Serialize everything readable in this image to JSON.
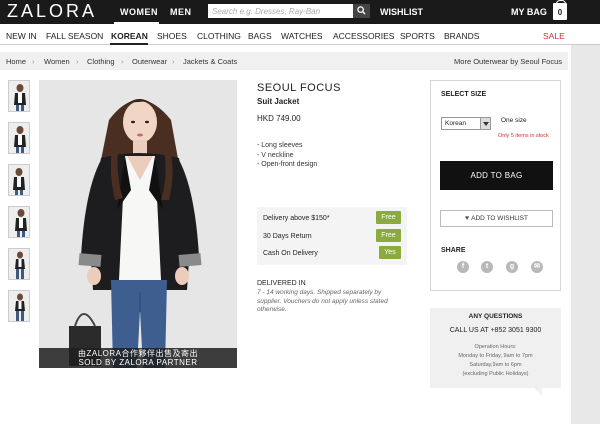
{
  "header": {
    "logo": "ZALORA",
    "nav": {
      "women": "WOMEN",
      "men": "MEN"
    },
    "search_placeholder": "Search e.g. Dresses, Ray-Ban",
    "wishlist": "WISHLIST",
    "mybag": "MY BAG",
    "bag_count": "0"
  },
  "categories": [
    "NEW IN",
    "FALL SEASON",
    "KOREAN",
    "SHOES",
    "CLOTHING",
    "BAGS",
    "WATCHES",
    "ACCESSORIES",
    "SPORTS",
    "BRANDS",
    "SALE"
  ],
  "breadcrumb": {
    "items": [
      "Home",
      "Women",
      "Clothing",
      "Outerwear",
      "Jackets & Coats"
    ],
    "more_link": "More Outerwear by Seoul Focus"
  },
  "photo": {
    "caption_line1": "由ZALORA合作夥伴出售及寄出",
    "caption_line2": "SOLD BY ZALORA PARTNER"
  },
  "product": {
    "brand": "SEOUL FOCUS",
    "name": "Suit Jacket",
    "price": "HKD 749.00",
    "features": [
      "- Long sleeves",
      "- V neckline",
      "- Open-front design"
    ]
  },
  "delivery": {
    "rows": [
      {
        "label": "Delivery above $150*",
        "badge": "Free"
      },
      {
        "label": "30 Days Return",
        "badge": "Free"
      },
      {
        "label": "Cash On Delivery",
        "badge": "Yes"
      }
    ],
    "delivered_title": "DELIVERED IN",
    "delivered_text": "7 - 14 working days. Shipped separately by supplier. Vouchers do not apply unless stated otherwise."
  },
  "buybox": {
    "select_size": "SELECT SIZE",
    "size_system": "Korean",
    "one_size": "One size",
    "stock": "Only 5 items in stock",
    "add_to_bag": "ADD TO BAG",
    "add_to_wishlist": "ADD TO WISHLIST",
    "share": "SHARE",
    "social_icons": [
      "facebook-icon",
      "twitter-icon",
      "google-plus-icon",
      "email-icon"
    ]
  },
  "questions": {
    "title": "ANY QUESTIONS",
    "phone": "CALL US AT +852 3051 9300",
    "hours": [
      "Operation Hours:",
      "Monday to Friday, 9am to 7pm",
      "Saturday,9am to 6pm",
      "(excluding Public Holidays)"
    ]
  },
  "colors": {
    "accent_green": "#8bab3e",
    "sale_red": "#cc3333",
    "topbar": "#1a1a1a"
  }
}
